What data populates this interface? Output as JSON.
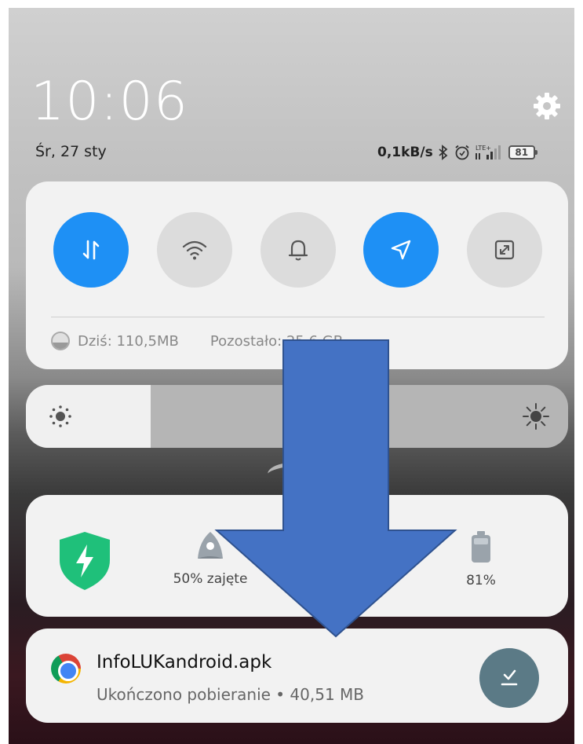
{
  "status": {
    "time": "10:06",
    "date": "Śr, 27 sty",
    "net_speed": "0,1kB/s",
    "network_type": "LTE+",
    "battery": "81",
    "icons": [
      "bluetooth-icon",
      "alarm-icon",
      "signal-icon",
      "battery-icon"
    ]
  },
  "quick_settings": {
    "toggles": [
      {
        "name": "mobile-data",
        "icon": "data-transfer-icon",
        "state": "on"
      },
      {
        "name": "wifi",
        "icon": "wifi-icon",
        "state": "off"
      },
      {
        "name": "sound",
        "icon": "bell-icon",
        "state": "off"
      },
      {
        "name": "location",
        "icon": "location-arrow-icon",
        "state": "on"
      },
      {
        "name": "auto-rotate",
        "icon": "rotate-icon",
        "state": "off"
      }
    ],
    "data_usage_today": "Dziś: 110,5MB",
    "data_usage_remaining": "Pozostało: 25,6 GB"
  },
  "brightness": {
    "level": 0.23
  },
  "security": {
    "storage_label": "50% zajęte",
    "battery_label": "81%"
  },
  "notification": {
    "title": "InfoLUKandroid.apk",
    "subtitle": "Ukończono pobieranie • 40,51 MB"
  },
  "colors": {
    "accent": "#1e90f5",
    "arrow_fill": "#4472c4",
    "arrow_stroke": "#2f528f",
    "shield": "#1fc07a",
    "action_button": "#5b7a86"
  }
}
